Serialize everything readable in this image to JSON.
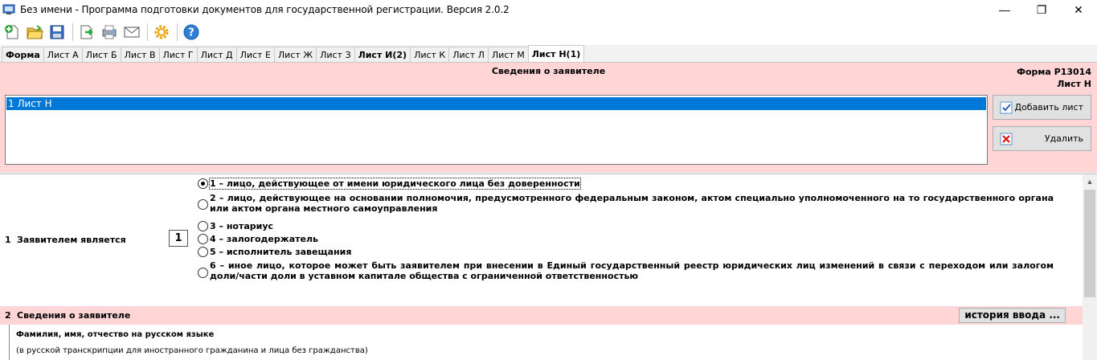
{
  "window": {
    "title": "Без имени - Программа подготовки документов для государственной регистрации. Версия 2.0.2",
    "minimize": "—",
    "maximize": "❐",
    "close": "✕"
  },
  "toolbar": {
    "buttons": [
      "new-document-icon",
      "open-folder-icon",
      "save-icon",
      "export-icon",
      "print-icon",
      "mail-icon",
      "settings-gear-icon",
      "help-icon"
    ]
  },
  "tabs": [
    {
      "label": "Форма",
      "bold": true
    },
    {
      "label": "Лист А"
    },
    {
      "label": "Лист Б"
    },
    {
      "label": "Лист В"
    },
    {
      "label": "Лист Г"
    },
    {
      "label": "Лист Д"
    },
    {
      "label": "Лист Е"
    },
    {
      "label": "Лист Ж"
    },
    {
      "label": "Лист З"
    },
    {
      "label": "Лист И(2)",
      "bold": true
    },
    {
      "label": "Лист К"
    },
    {
      "label": "Лист Л"
    },
    {
      "label": "Лист М"
    },
    {
      "label": "Лист Н(1)",
      "active": true
    }
  ],
  "header": {
    "title": "Сведения о заявителе",
    "form_code": "Форма Р13014",
    "sheet_code": "Лист Н"
  },
  "sheet_list": {
    "items": [
      "1 Лист Н"
    ],
    "selected": 0
  },
  "buttons": {
    "add_sheet": "Добавить лист",
    "delete": "Удалить",
    "history": "история ввода ..."
  },
  "section1": {
    "number": "1",
    "label": "Заявителем является",
    "value": "1",
    "options": [
      "1 – лицо, действующее от имени юридического лица без доверенности",
      "2 – лицо, действующее на основании полномочия, предусмотренного федеральным законом, актом специально уполномоченного на то государственного органа или актом органа местного самоуправления",
      "3 – нотариус",
      "4 – залогодержатель",
      "5 – исполнитель завещания",
      "6 – иное лицо, которое может быть заявителем при внесении в Единый государственный реестр юридических лиц изменений в связи с переходом или залогом доли/части доли в уставном капитале общества с ограниченной ответственностью"
    ],
    "selected_index": 0
  },
  "section2": {
    "number": "2",
    "label": "Сведения о заявителе",
    "fio_label": "Фамилия, имя, отчество на русском языке",
    "fio_note": "(в русской транскрипции для иностранного гражданина и лица без гражданства)"
  }
}
